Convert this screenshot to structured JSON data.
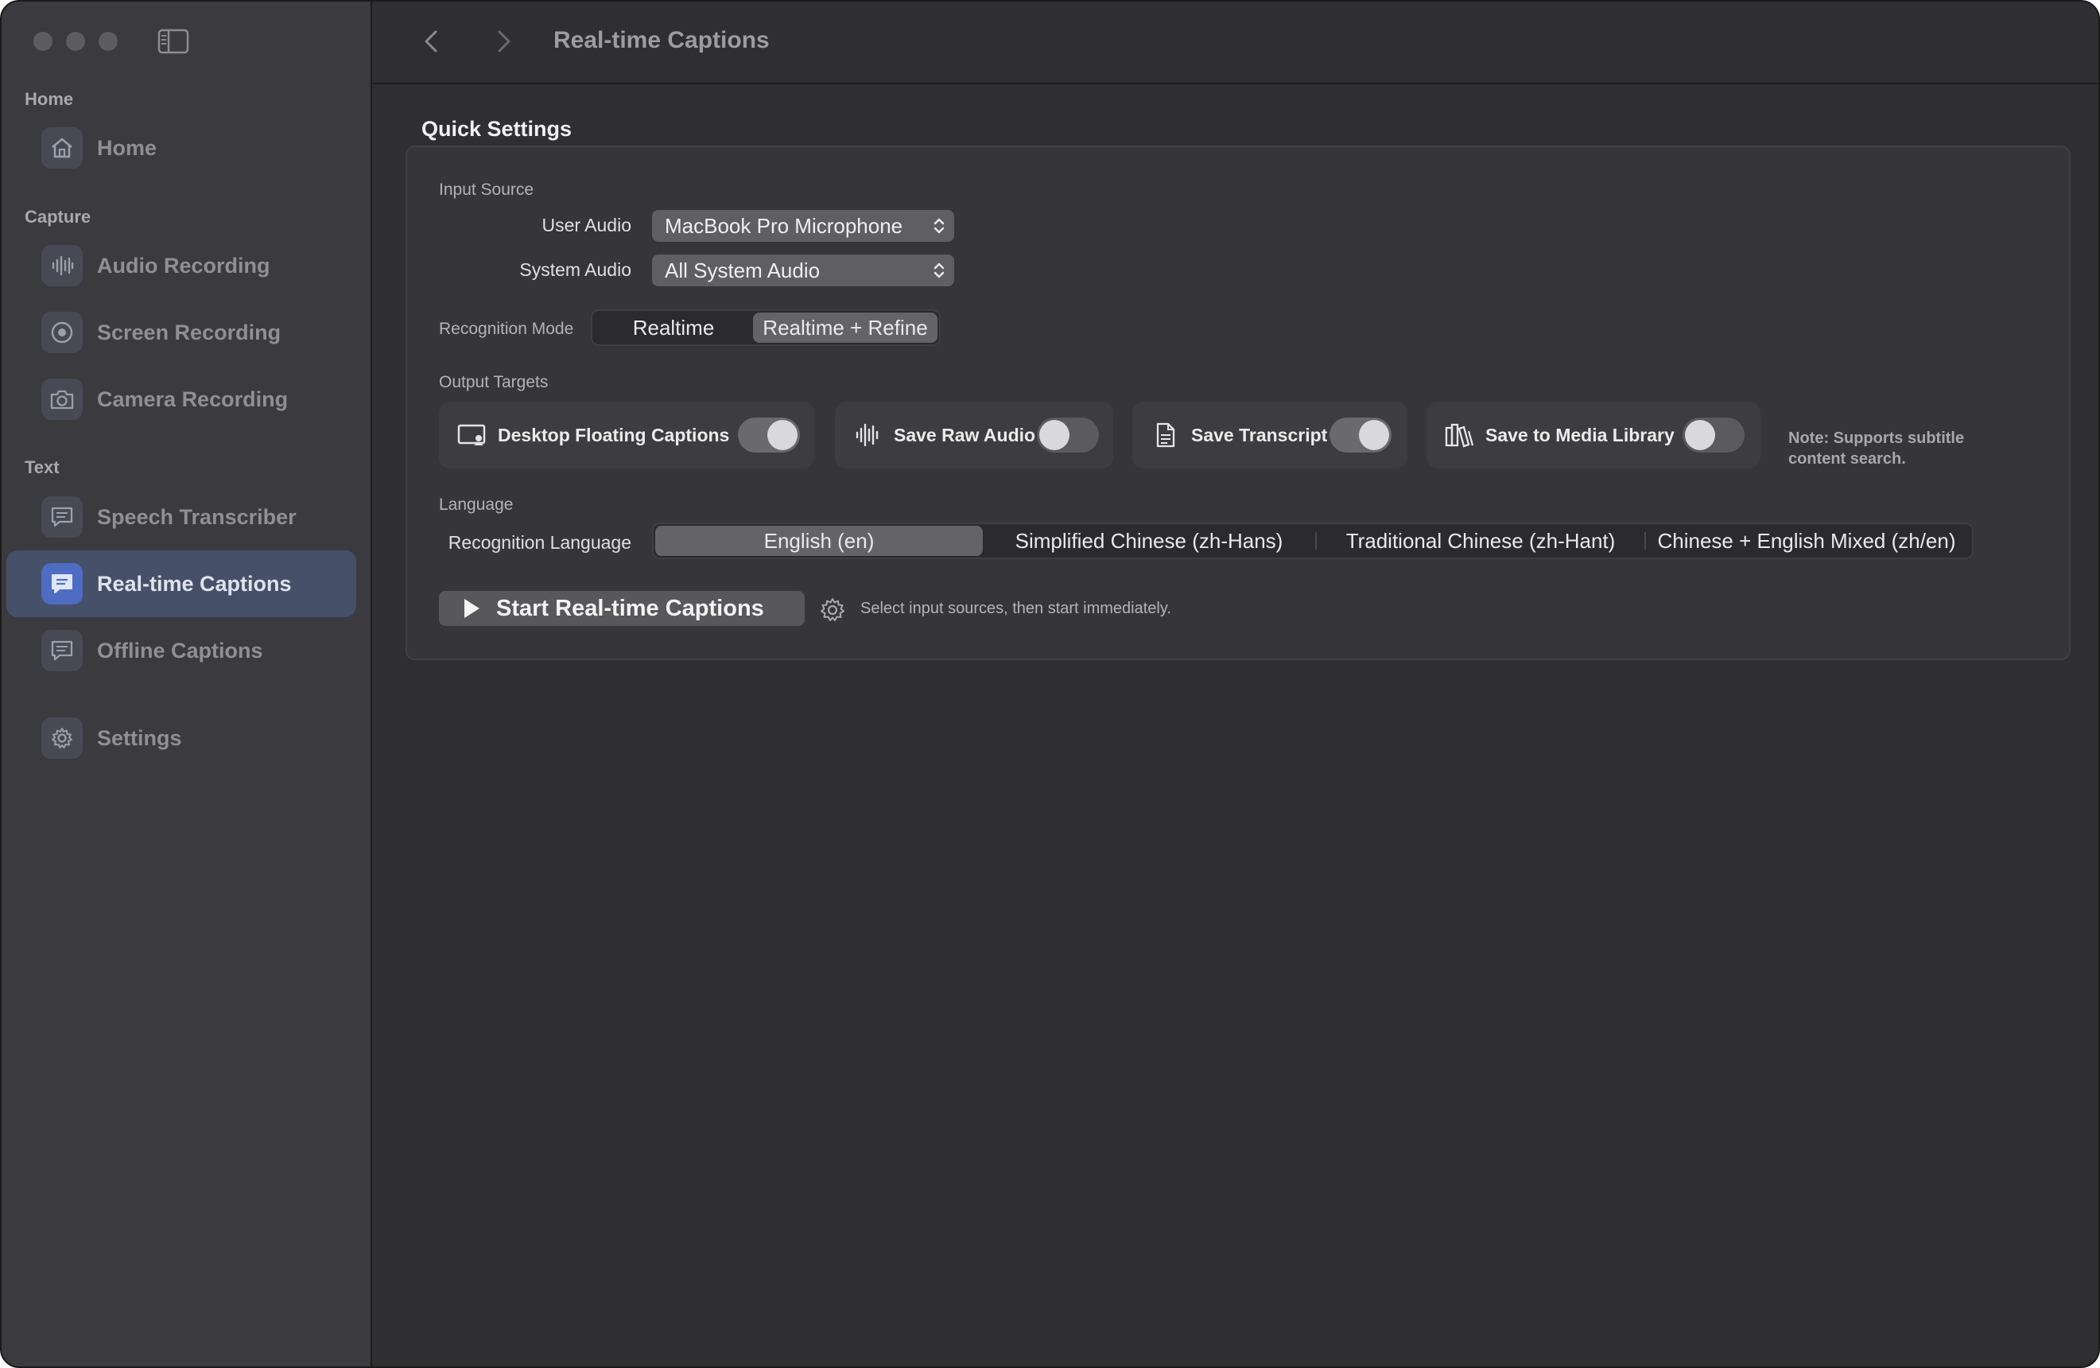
{
  "window": {
    "title": "Real-time Captions"
  },
  "sidebar": {
    "sections": {
      "home": "Home",
      "capture": "Capture",
      "text": "Text"
    },
    "items": [
      {
        "label": "Home",
        "icon": "house-icon"
      },
      {
        "label": "Audio Recording",
        "icon": "waveform-icon"
      },
      {
        "label": "Screen Recording",
        "icon": "record-icon"
      },
      {
        "label": "Camera Recording",
        "icon": "camera-icon"
      },
      {
        "label": "Speech Transcriber",
        "icon": "text-bubble-icon"
      },
      {
        "label": "Real-time Captions",
        "icon": "caption-bubble-icon",
        "active": true
      },
      {
        "label": "Offline Captions",
        "icon": "caption-bubble-icon"
      },
      {
        "label": "Settings",
        "icon": "gear-icon"
      }
    ]
  },
  "quick_settings": {
    "title": "Quick Settings",
    "input_source": {
      "label": "Input Source",
      "user_audio_label": "User Audio",
      "user_audio_value": "MacBook Pro Microphone",
      "system_audio_label": "System Audio",
      "system_audio_value": "All System Audio"
    },
    "recognition_mode": {
      "label": "Recognition Mode",
      "options": [
        "Realtime",
        "Realtime + Refine"
      ],
      "selected": "Realtime + Refine"
    },
    "output_targets": {
      "label": "Output Targets",
      "items": [
        {
          "label": "Desktop Floating Captions",
          "icon": "floating-caption-icon",
          "on": true
        },
        {
          "label": "Save Raw Audio",
          "icon": "waveform-icon",
          "on": false
        },
        {
          "label": "Save Transcript",
          "icon": "document-icon",
          "on": true
        },
        {
          "label": "Save to Media Library",
          "icon": "books-icon",
          "on": false
        }
      ],
      "note": "Note: Supports subtitle content search."
    },
    "language": {
      "label": "Language",
      "recognition_language_label": "Recognition Language",
      "options": [
        "English (en)",
        "Simplified Chinese (zh-Hans)",
        "Traditional Chinese (zh-Hant)",
        "Chinese + English Mixed (zh/en)"
      ],
      "selected": "English (en)"
    },
    "start_button": "Start Real-time Captions",
    "hint": "Select input sources, then start immediately."
  }
}
